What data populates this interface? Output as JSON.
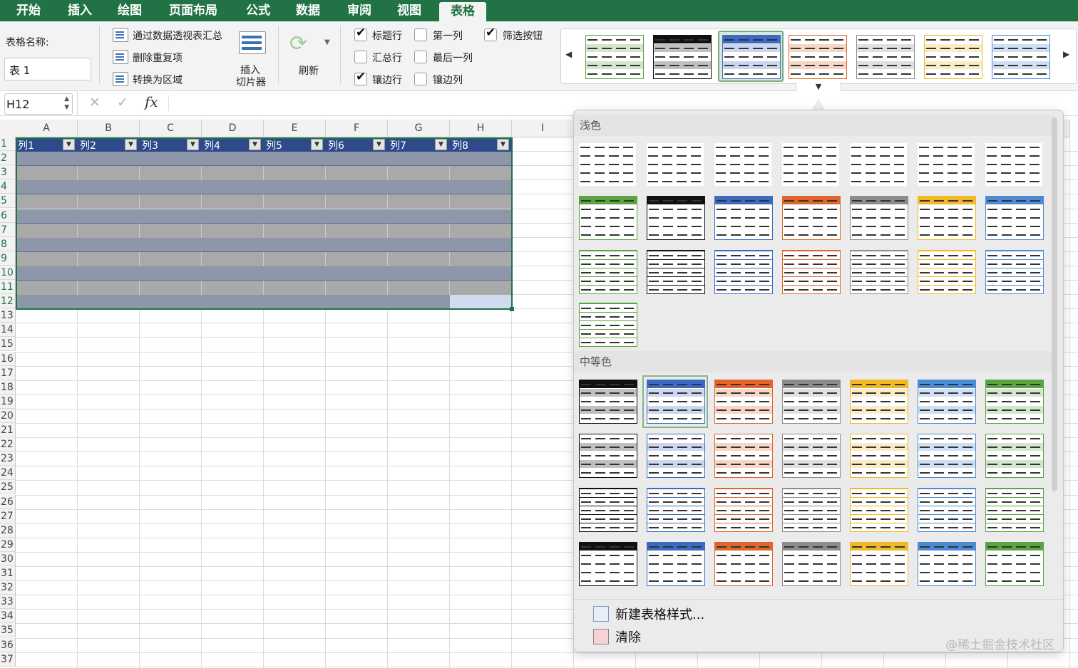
{
  "ribbon_tabs": [
    "开始",
    "插入",
    "绘图",
    "页面布局",
    "公式",
    "数据",
    "审阅",
    "视图",
    "表格"
  ],
  "active_tab": "表格",
  "table_name_label": "表格名称:",
  "table_name_value": "表 1",
  "tools": {
    "pivot": "通过数据透视表汇总",
    "remove_dup": "删除重复项",
    "convert": "转换为区域",
    "slicer_line1": "插入",
    "slicer_line2": "切片器",
    "refresh": "刷新"
  },
  "checkboxes": [
    {
      "label": "标题行",
      "checked": true
    },
    {
      "label": "汇总行",
      "checked": false
    },
    {
      "label": "镶边行",
      "checked": true
    },
    {
      "label": "第一列",
      "checked": false
    },
    {
      "label": "最后一列",
      "checked": false
    },
    {
      "label": "镶边列",
      "checked": false
    },
    {
      "label": "筛选按钮",
      "checked": true
    }
  ],
  "name_box": "H12",
  "formula_icons": {
    "cancel": "✕",
    "enter": "✓",
    "fx": "fx"
  },
  "columns": [
    "A",
    "B",
    "C",
    "D",
    "E",
    "F",
    "G",
    "H",
    "I"
  ],
  "rows": [
    "1",
    "2",
    "3",
    "4",
    "5",
    "6",
    "7",
    "8",
    "9",
    "10",
    "11",
    "12",
    "13",
    "14",
    "15",
    "16",
    "17",
    "18",
    "19",
    "20",
    "21",
    "22",
    "23",
    "24",
    "25",
    "26",
    "27",
    "28",
    "29",
    "30",
    "31",
    "32",
    "33",
    "34",
    "35",
    "36",
    "37"
  ],
  "table_headers": [
    "列1",
    "列2",
    "列3",
    "列4",
    "列5",
    "列6",
    "列7",
    "列8"
  ],
  "panel": {
    "section_light": "浅色",
    "section_medium": "中等色",
    "new_style": "新建表格样式...",
    "clear": "清除"
  },
  "watermark": "@稀土掘金技术社区",
  "colors": {
    "excel_green": "#217346",
    "table_header": "#2f4a8a",
    "band_dark": "#8e96aa",
    "band_light": "#a9a9a9",
    "blue": "#3b69c4",
    "orange": "#e0652a",
    "gray": "#8c8c8c",
    "yellow": "#f2b825",
    "lightblue": "#4c8ad6",
    "green": "#5aa441"
  }
}
